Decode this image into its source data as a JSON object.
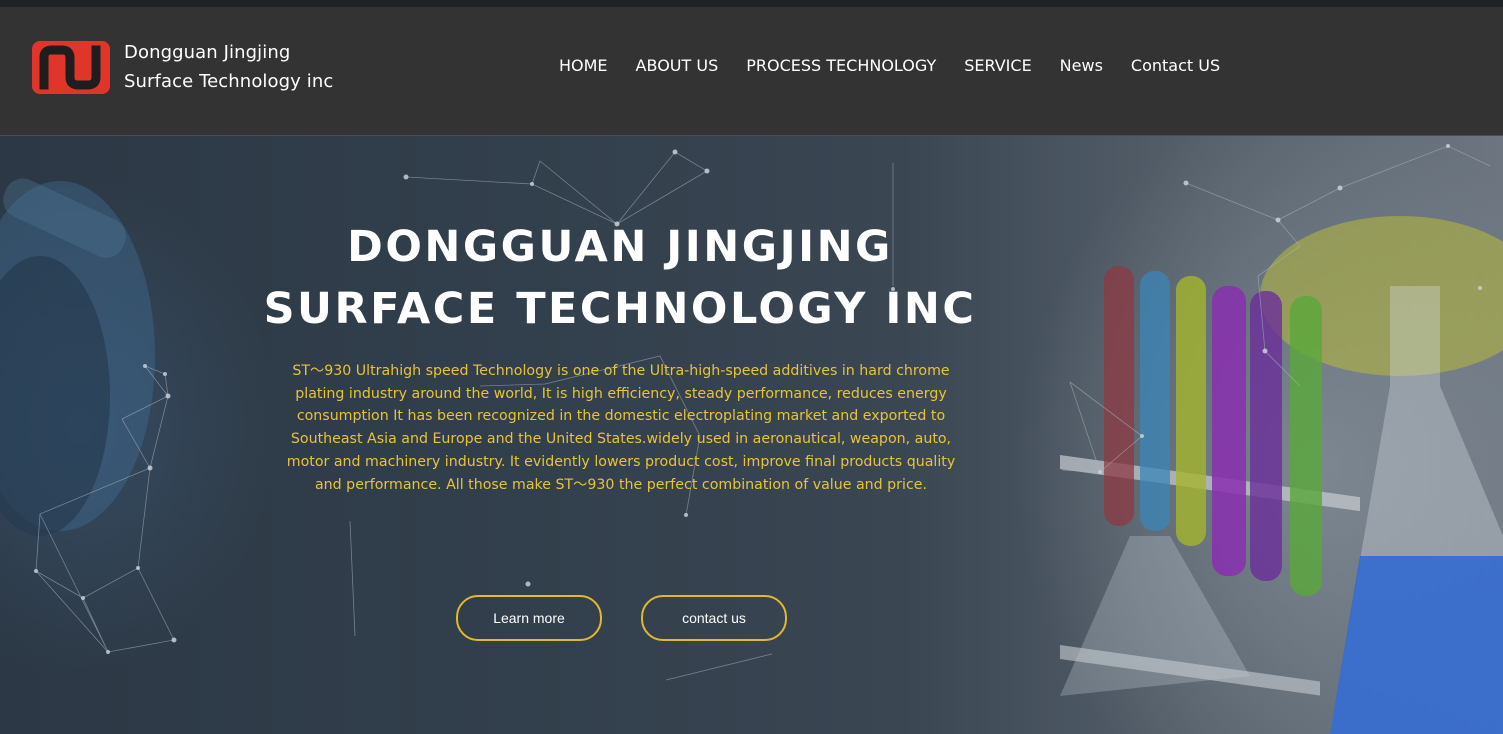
{
  "brand": {
    "name_line1": "Dongguan Jingjing",
    "name_line2": "Surface Technology inc",
    "logo_color": "#e0352b"
  },
  "nav": {
    "items": [
      "HOME",
      "ABOUT US",
      "PROCESS TECHNOLOGY",
      "SERVICE",
      "News",
      "Contact US"
    ]
  },
  "hero": {
    "title_line1": "DONGGUAN JINGJING",
    "title_line2": "SURFACE TECHNOLOGY INC",
    "description": "ST～930 Ultrahigh speed  Technology is one of the Ultra-high-speed additives in hard chrome plating industry around the world, It is high efficiency, steady performance, reduces energy consumption It has been recognized in the domestic electroplating market and exported to Southeast Asia and Europe and the United States.widely used in aeronautical, weapon, auto, motor and machinery industry. It evidently lowers product cost, improve final products quality and performance. All those make ST～930 the perfect combination of value and price.",
    "buttons": {
      "learn_more": "Learn more",
      "contact_us": "contact us"
    },
    "accent_color": "#e1b830",
    "description_color": "#e8c33a"
  }
}
